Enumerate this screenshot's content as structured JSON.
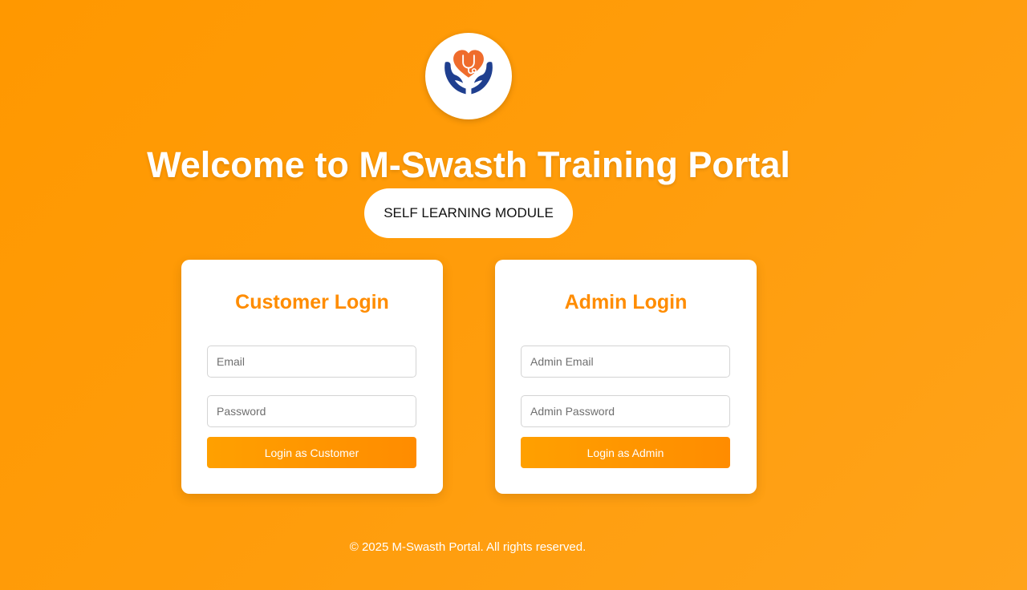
{
  "header": {
    "logo_icon": "hands-heart-stethoscope-icon",
    "title": "Welcome to M-Swasth Training Portal",
    "module_button": "SELF LEARNING MODULE"
  },
  "customer_login": {
    "heading": "Customer Login",
    "email_placeholder": "Email",
    "password_placeholder": "Password",
    "submit_label": "Login as Customer"
  },
  "admin_login": {
    "heading": "Admin Login",
    "email_placeholder": "Admin Email",
    "password_placeholder": "Admin Password",
    "submit_label": "Login as Admin"
  },
  "footer": {
    "text": "© 2025 M-Swasth Portal. All rights reserved."
  },
  "colors": {
    "background": "#ff9800",
    "accent": "#ff8c00",
    "logo_heart": "#ef6c2c",
    "logo_hands": "#1f3f8f"
  }
}
